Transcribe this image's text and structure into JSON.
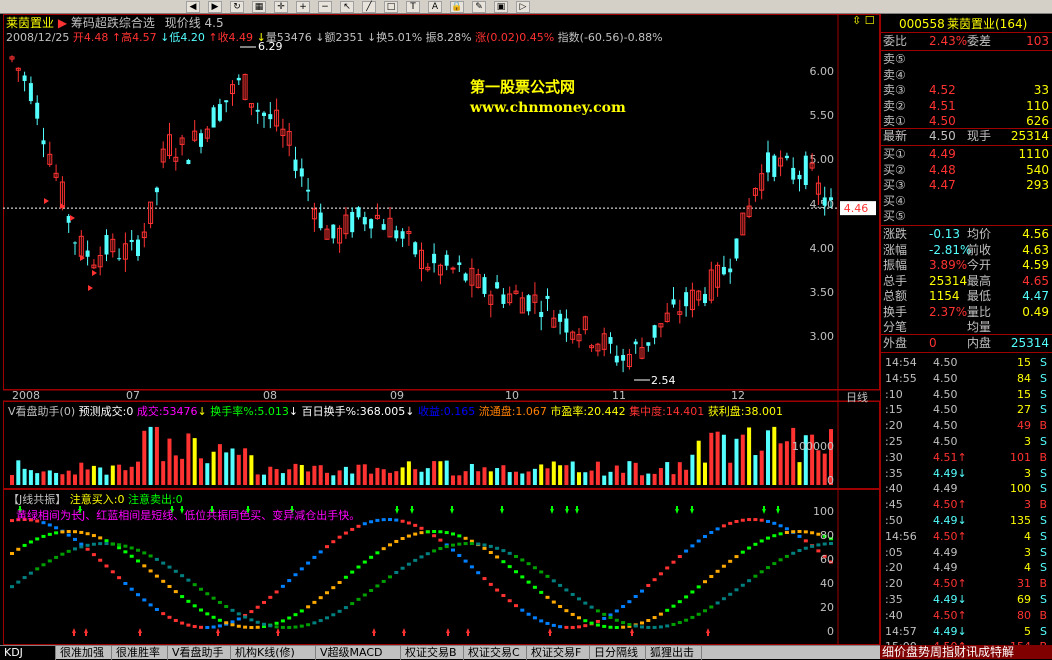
{
  "toolbar_icons": [
    "back",
    "forward",
    "refresh",
    "chart",
    "cross",
    "zoom-in",
    "zoom-out",
    "pointer",
    "line",
    "rect",
    "text",
    "font",
    "lock",
    "pen",
    "bag",
    "play"
  ],
  "stock": {
    "name": "莱茵置业",
    "code": "000558",
    "fullname": "莱茵置业(164)",
    "indicator": "筹码超跌综合选",
    "curline": "现价线 4.5"
  },
  "ohlc": {
    "date": "2008/12/25",
    "open": "开4.48",
    "high": "高4.57",
    "low": "低4.20",
    "close": "收4.49",
    "vol": "量53476",
    "amt": "额2351",
    "turn": "换5.01%",
    "amp": "振8.28%",
    "chg": "涨(0.02)0.45%",
    "idx": "指数(-60.56)-0.88%"
  },
  "price_axis": [
    "6.00",
    "5.50",
    "5.00",
    "4.50",
    "4.00",
    "3.50",
    "3.00"
  ],
  "price_marker": "4.46",
  "peak_label": "6.29",
  "trough_label": "2.54",
  "watermark": {
    "line1": "第一股票公式网",
    "line2": "www.chnmoney.com"
  },
  "x_axis": [
    "2008",
    "07",
    "08",
    "09",
    "10",
    "11",
    "12"
  ],
  "x_unit": "日线",
  "vol_indicator": {
    "name": "V看盘助手(0)",
    "pred": "预测成交:0",
    "cj": "成交:53476",
    "hsl": "换手率%:5.013",
    "bh": "百日换手%:368.005",
    "sy": "收益:0.165",
    "ltp": "流通盘:1.067",
    "syl": "市盈率:20.442",
    "jzd": "集中度:14.401",
    "hlp": "获利盘:38.001"
  },
  "vol_axis": [
    "100000",
    "0"
  ],
  "kdj_indicator": {
    "name": "【J线共振】",
    "buy": "注意买入:0",
    "sell": "注意卖出:0",
    "note": "黄绿相间为长J、红蓝相间是短线、低位共振同色买、变异减仓出手快。"
  },
  "kdj_axis": [
    "100",
    "80",
    "60",
    "40",
    "20",
    "0"
  ],
  "tabs": [
    "KDJ",
    "很准加强",
    "很准胜率",
    "V看盘助手",
    "机构K线(修)",
    "V超级MACD",
    "权证交易B",
    "权证交易C",
    "权证交易F",
    "日分隔线",
    "狐狸出击"
  ],
  "quote": {
    "weibi_l": "委比",
    "weibi": "2.43%",
    "weicha_l": "委差",
    "weicha": "103",
    "sells": [
      {
        "l": "卖⑤",
        "p": "",
        "v": ""
      },
      {
        "l": "卖④",
        "p": "",
        "v": ""
      },
      {
        "l": "卖③",
        "p": "4.52",
        "v": "33"
      },
      {
        "l": "卖②",
        "p": "4.51",
        "v": "110"
      },
      {
        "l": "卖①",
        "p": "4.50",
        "v": "626"
      }
    ],
    "last_l": "最新",
    "last": "4.50",
    "xs_l": "现手",
    "xs": "25314",
    "buys": [
      {
        "l": "买①",
        "p": "4.49",
        "v": "1110"
      },
      {
        "l": "买②",
        "p": "4.48",
        "v": "540"
      },
      {
        "l": "买③",
        "p": "4.47",
        "v": "293"
      },
      {
        "l": "买④",
        "p": "",
        "v": ""
      },
      {
        "l": "买⑤",
        "p": "",
        "v": ""
      }
    ],
    "stats": [
      {
        "a": "涨跌",
        "b": "-0.13",
        "c": "均价",
        "d": "4.56"
      },
      {
        "a": "涨幅",
        "b": "-2.81%",
        "c": "前收",
        "d": "4.63"
      },
      {
        "a": "振幅",
        "b": "3.89%",
        "c": "今开",
        "d": "4.59"
      },
      {
        "a": "总手",
        "b": "25314",
        "c": "最高",
        "d": "4.65"
      },
      {
        "a": "总额",
        "b": "1154",
        "c": "最低",
        "d": "4.47"
      },
      {
        "a": "换手",
        "b": "2.37%",
        "c": "量比",
        "d": "0.49"
      },
      {
        "a": "分笔",
        "b": "",
        "c": "均量",
        "d": ""
      }
    ],
    "wp_l": "外盘",
    "wp": "0",
    "np_l": "内盘",
    "np": "25314"
  },
  "ticks": [
    {
      "t": "14:54",
      "p": "4.50",
      "v": "15",
      "s": "S"
    },
    {
      "t": "14:55",
      "p": "4.50",
      "v": "84",
      "s": "S"
    },
    {
      "t": ":10",
      "p": "4.50",
      "v": "15",
      "s": "S"
    },
    {
      "t": ":15",
      "p": "4.50",
      "v": "27",
      "s": "S"
    },
    {
      "t": ":20",
      "p": "4.50",
      "v": "49",
      "s": "B"
    },
    {
      "t": ":25",
      "p": "4.50",
      "v": "3",
      "s": "S"
    },
    {
      "t": ":30",
      "p": "4.51↑",
      "v": "101",
      "s": "B"
    },
    {
      "t": ":35",
      "p": "4.49↓",
      "v": "3",
      "s": "S"
    },
    {
      "t": ":40",
      "p": "4.49",
      "v": "100",
      "s": "S"
    },
    {
      "t": ":45",
      "p": "4.50↑",
      "v": "3",
      "s": "B"
    },
    {
      "t": ":50",
      "p": "4.49↓",
      "v": "135",
      "s": "S"
    },
    {
      "t": "14:56",
      "p": "4.50↑",
      "v": "4",
      "s": "S"
    },
    {
      "t": ":05",
      "p": "4.49",
      "v": "3",
      "s": "S"
    },
    {
      "t": ":20",
      "p": "4.49",
      "v": "4",
      "s": "S"
    },
    {
      "t": ":20",
      "p": "4.50↑",
      "v": "31",
      "s": "B"
    },
    {
      "t": ":35",
      "p": "4.49↓",
      "v": "69",
      "s": "S"
    },
    {
      "t": ":40",
      "p": "4.50↑",
      "v": "80",
      "s": "B"
    },
    {
      "t": "14:57",
      "p": "4.49↓",
      "v": "5",
      "s": "S"
    },
    {
      "t": "15:00",
      "p": "4.50↑",
      "v": "154",
      "s": "B"
    }
  ],
  "bottom_tabs": "细价盘势周指财讯成特解",
  "colors": {
    "up": "#ff3232",
    "down": "#54ffff",
    "bg": "#000000",
    "frame": "#a00000",
    "yellow": "#ffff00",
    "green": "#00ff00"
  }
}
